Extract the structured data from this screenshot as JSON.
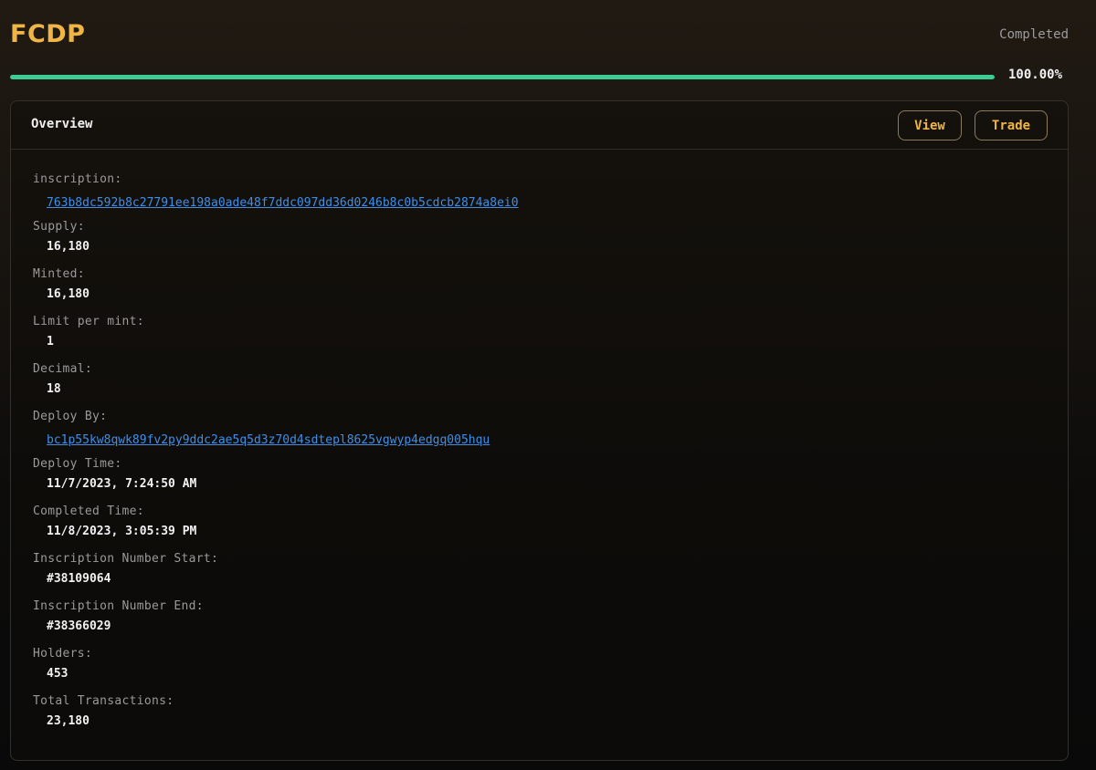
{
  "header": {
    "title": "FCDP",
    "status": "Completed"
  },
  "progress": {
    "percent": 100,
    "label": "100.00%",
    "color": "#3ccc95"
  },
  "panel": {
    "title": "Overview",
    "view_label": "View",
    "trade_label": "Trade"
  },
  "fields": [
    {
      "label": "inscription:",
      "value": "763b8dc592b8c27791ee198a0ade48f7ddc097dd36d0246b8c0b5cdcb2874a8ei0",
      "link": true
    },
    {
      "label": "Supply:",
      "value": "16,180"
    },
    {
      "label": "Minted:",
      "value": "16,180"
    },
    {
      "label": "Limit per mint:",
      "value": "1"
    },
    {
      "label": "Decimal:",
      "value": "18"
    },
    {
      "label": "Deploy By:",
      "value": "bc1p55kw8qwk89fv2py9ddc2ae5q5d3z70d4sdtepl8625vgwyp4edgq005hqu",
      "link": true
    },
    {
      "label": "Deploy Time:",
      "value": "11/7/2023, 7:24:50 AM"
    },
    {
      "label": "Completed Time:",
      "value": "11/8/2023, 3:05:39 PM"
    },
    {
      "label": "Inscription Number Start:",
      "value": "#38109064"
    },
    {
      "label": "Inscription Number End:",
      "value": "#38366029"
    },
    {
      "label": "Holders:",
      "value": "453"
    },
    {
      "label": "Total Transactions:",
      "value": "23,180"
    }
  ],
  "colors": {
    "accent": "#f0b547",
    "link": "#3f8ee8"
  }
}
